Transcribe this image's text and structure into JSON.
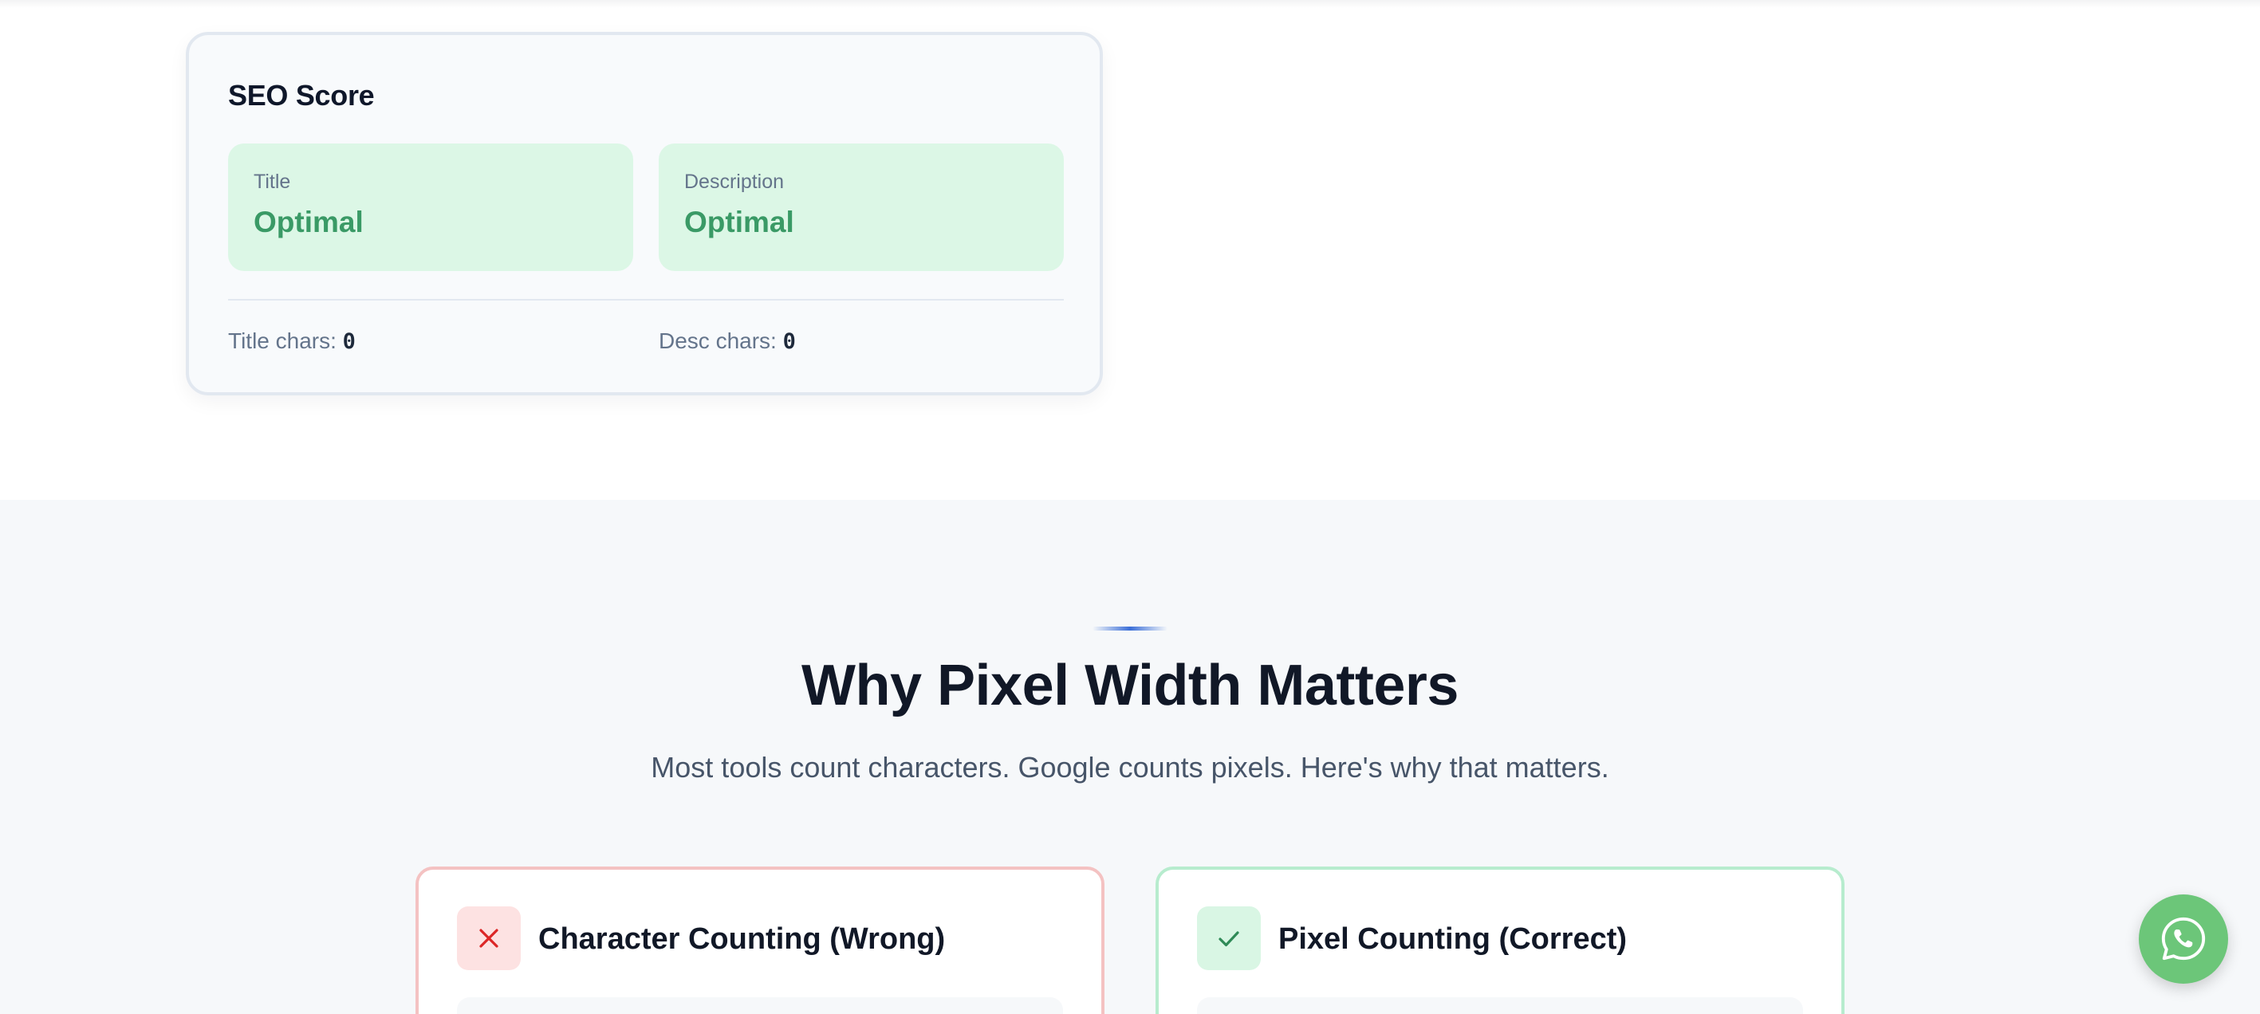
{
  "seo_card": {
    "title": "SEO Score",
    "title_score": {
      "label": "Title",
      "value": "Optimal"
    },
    "description_score": {
      "label": "Description",
      "value": "Optimal"
    },
    "title_chars_label": "Title chars:",
    "title_chars_value": "0",
    "desc_chars_label": "Desc chars:",
    "desc_chars_value": "0"
  },
  "why_section": {
    "heading": "Why Pixel Width Matters",
    "subheading": "Most tools count characters. Google counts pixels. Here's why that matters.",
    "wrong_card": {
      "icon": "x-icon",
      "title": "Character Counting (Wrong)"
    },
    "correct_card": {
      "icon": "check-icon",
      "title": "Pixel Counting (Correct)"
    }
  },
  "floating_button": {
    "icon": "whatsapp-icon"
  },
  "colors": {
    "optimal_bg": "#dcf7e6",
    "optimal_text": "#3a9a66",
    "wrong_border": "#f4c2c2",
    "wrong_icon": "#dc2626",
    "correct_border": "#b7ecce",
    "correct_icon": "#2f8a57",
    "whatsapp": "#6cc679"
  }
}
